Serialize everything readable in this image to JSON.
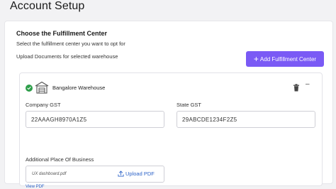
{
  "page": {
    "title": "Account Setup"
  },
  "section": {
    "title": "Choose the Fulfillment Center",
    "subtitle": "Select the fulfillment center you want to opt for",
    "upload_desc": "Upload Documents for selected warehouse",
    "add_button_label": "Add Fulfillment Center"
  },
  "warehouse": {
    "name": "Bangalore Warehouse",
    "company_gst_label": "Company GST",
    "company_gst_value": "22AAAGH8970A1Z5",
    "state_gst_label": "State GST",
    "state_gst_value": "29ABCDE1234F2Z5",
    "additional_label": "Additional Place Of Business",
    "file_name": "UX dashboard.pdf",
    "upload_label": "Upload PDF",
    "view_pdf_label": "View PDF"
  },
  "colors": {
    "accent": "#7a5af5",
    "success": "#2e9e4a",
    "link": "#2d63c8"
  },
  "icons": {
    "check": "check-circle-icon",
    "warehouse": "warehouse-icon",
    "delete": "trash-icon",
    "collapse": "minus-icon",
    "upload": "upload-icon",
    "add": "plus-icon"
  }
}
